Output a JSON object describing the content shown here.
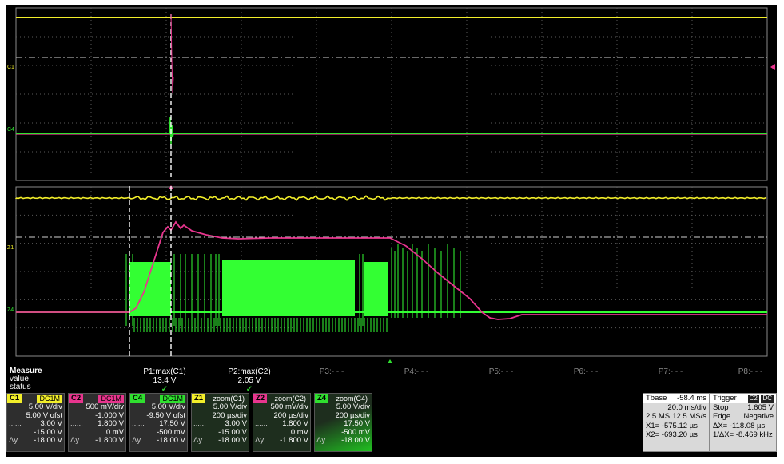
{
  "channel_markers": {
    "c1": "C1",
    "c4": "C4",
    "z1": "Z1",
    "z4": "Z4"
  },
  "colors": {
    "c1": "#f2ee2a",
    "c2": "#e8358e",
    "c4": "#2fe02f",
    "z4": "#33ff33",
    "grid": "#5a5a5a"
  },
  "measure": {
    "title": "Measure",
    "row_value": "value",
    "row_status": "status",
    "params": [
      {
        "name": "P1:max(C1)",
        "value": "13.4 V",
        "status": "✓"
      },
      {
        "name": "P2:max(C2)",
        "value": "2.05 V",
        "status": "✓"
      },
      {
        "name": "P3:- - -",
        "value": "",
        "status": ""
      },
      {
        "name": "P4:- - -",
        "value": "",
        "status": ""
      },
      {
        "name": "P5:- - -",
        "value": "",
        "status": ""
      },
      {
        "name": "P6:- - -",
        "value": "",
        "status": ""
      },
      {
        "name": "P7:- - -",
        "value": "",
        "status": ""
      },
      {
        "name": "P8:- - -",
        "value": "",
        "status": ""
      }
    ]
  },
  "tiles": [
    {
      "name": "C1",
      "coupling": "DC1M",
      "color": "#f2ee2a",
      "rows": [
        [
          "",
          "5.00 V/div"
        ],
        [
          "",
          "5.00 V ofst"
        ],
        [
          "......",
          "3.00 V"
        ],
        [
          "......",
          "-15.00 V"
        ],
        [
          "Δy",
          "-18.00 V"
        ]
      ]
    },
    {
      "name": "C2",
      "coupling": "DC1M",
      "color": "#e8358e",
      "rows": [
        [
          "",
          "500 mV/div"
        ],
        [
          "",
          "-1.000 V"
        ],
        [
          "......",
          "1.800 V"
        ],
        [
          "......",
          "0 mV"
        ],
        [
          "Δy",
          "-1.800 V"
        ]
      ]
    },
    {
      "name": "C4",
      "coupling": "DC1M",
      "color": "#2fe02f",
      "rows": [
        [
          "",
          "5.00 V/div"
        ],
        [
          "",
          "-9.50 V ofst"
        ],
        [
          "......",
          "17.50 V"
        ],
        [
          "......",
          "-500 mV"
        ],
        [
          "Δy",
          "-18.00 V"
        ]
      ]
    },
    {
      "name": "Z1",
      "coupling": "zoom(C1)",
      "color": "#f2ee2a",
      "rows": [
        [
          "",
          "5.00 V/div"
        ],
        [
          "",
          "200 µs/div"
        ],
        [
          "......",
          "3.00 V"
        ],
        [
          "......",
          "-15.00 V"
        ],
        [
          "Δy",
          "-18.00 V"
        ]
      ]
    },
    {
      "name": "Z2",
      "coupling": "zoom(C2)",
      "color": "#e8358e",
      "rows": [
        [
          "",
          "500 mV/div"
        ],
        [
          "",
          "200 µs/div"
        ],
        [
          "......",
          "1.800 V"
        ],
        [
          "......",
          "0 mV"
        ],
        [
          "Δy",
          "-1.800 V"
        ]
      ]
    },
    {
      "name": "Z4",
      "coupling": "zoom(C4)",
      "color": "#2fe02f",
      "rows": [
        [
          "",
          "5.00 V/div"
        ],
        [
          "",
          "200 µs/div"
        ],
        [
          "",
          "17.50 V"
        ],
        [
          "",
          "-500 mV"
        ],
        [
          "Δy",
          "-18.00 V"
        ]
      ]
    }
  ],
  "timebase": {
    "label": "Tbase",
    "offset": "-58.4 ms",
    "per_div": "20.0 ms/div",
    "samples": "2.5 MS",
    "rate": "12.5 MS/s",
    "x1": "X1= -575.12 µs",
    "x2": "X2= -693.20 µs"
  },
  "trigger": {
    "label": "Trigger",
    "source": "C2",
    "coupling": "DC",
    "mode": "Stop",
    "level": "1.605 V",
    "type": "Edge",
    "slope": "Negative",
    "dx": "ΔX= -118.08 µs",
    "inv_dx": "1/ΔX= -8.469 kHz"
  }
}
